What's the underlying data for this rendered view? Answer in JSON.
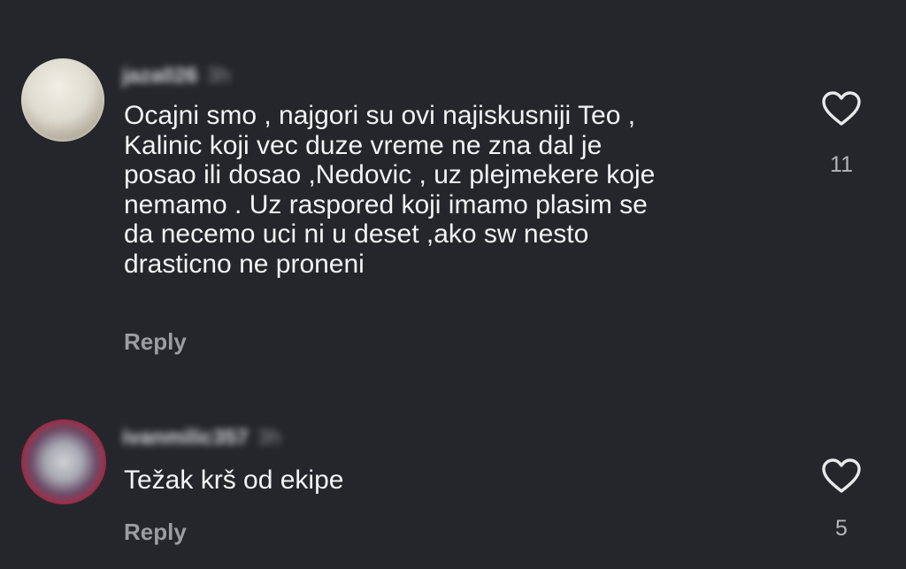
{
  "comments": [
    {
      "username": "jaza026",
      "time": "3h",
      "text": "Ocajni smo , najgori su ovi najiskusniji Teo ,\nKalinic koji vec duze vreme ne zna dal je\nposao ili dosao ,Nedovic , uz plejmekere koje\nnemamo . Uz raspored koji imamo plasim se\nda necemo uci ni u deset ,ako sw nesto\ndrasticno ne proneni",
      "reply_label": "Reply",
      "like_icon": "heart-outline-icon",
      "like_count": "11"
    },
    {
      "username": "ivanmilic357",
      "time": "3h",
      "text": "Težak krš od ekipe",
      "reply_label": "Reply",
      "like_icon": "heart-outline-icon",
      "like_count": "5"
    }
  ],
  "colors": {
    "background": "#25262b",
    "text": "#f3f3f5",
    "secondary": "#9c9da3"
  }
}
